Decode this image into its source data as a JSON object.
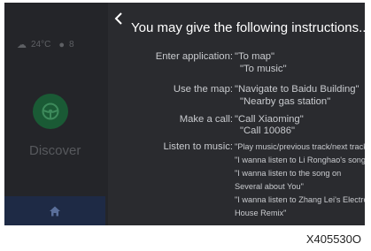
{
  "home": {
    "temperature": "24°C",
    "status_partial": "8",
    "discover_label": "Discover"
  },
  "panel": {
    "title": "You may give the following instructions...",
    "sections": [
      {
        "label": "Enter application:",
        "lines": [
          "\"To map\"",
          "\"To music\""
        ]
      },
      {
        "label": "Use the map:",
        "lines": [
          "\"Navigate to Baidu Building\"",
          "\"Nearby gas station\""
        ]
      },
      {
        "label": "Make a call:",
        "lines": [
          "\"Call Xiaoming\"",
          "\"Call 10086\""
        ]
      },
      {
        "label": "Listen to music:",
        "lines": [
          "\"Play music/previous track/next track\"",
          "\"I wanna listen to Li Ronghao's song\"",
          "\"I wanna listen to the song on",
          "Several about You\"",
          "\"I wanna listen to Zhang Lei's Electro",
          "House Remix\""
        ]
      }
    ]
  },
  "caption": "X405530O",
  "colors": {
    "background": "#1d1e22",
    "panel": "#2a2b2f",
    "accent_green": "#1a5a35",
    "home_tab": "#1e2a45"
  }
}
